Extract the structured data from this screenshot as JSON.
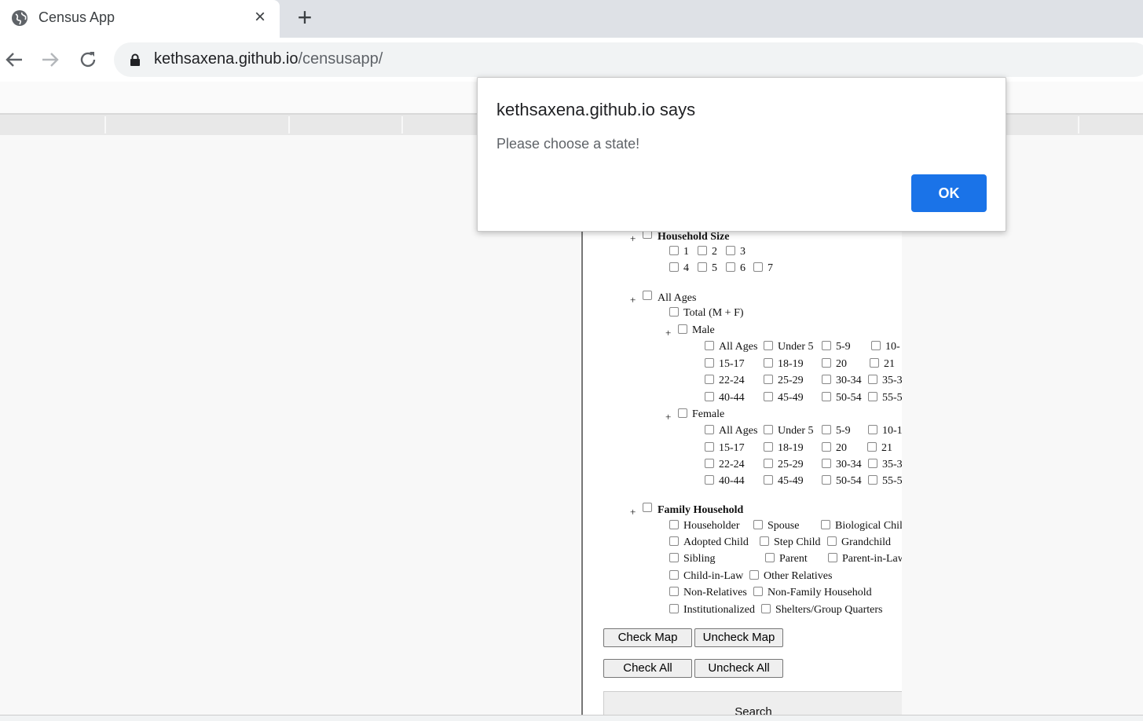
{
  "browser": {
    "tab_title": "Census App",
    "close_glyph": "×",
    "new_tab_glyph": "+",
    "url_host": "kethsaxena.github.io",
    "url_path": "/censusapp/"
  },
  "dialog": {
    "title": "kethsaxena.github.io says",
    "message": "Please choose a state!",
    "ok_label": "OK",
    "ok_color": "#1a73e8"
  },
  "form": {
    "household_size": {
      "label": "Household Size",
      "options": [
        "1",
        "2",
        "3",
        "4",
        "5",
        "6",
        "7"
      ]
    },
    "ages": {
      "label": "All Ages",
      "total": "Total (M + F)",
      "male": {
        "label": "Male",
        "options": [
          "All Ages",
          "Under 5",
          "5-9",
          "10-",
          "15-17",
          "18-19",
          "20",
          "21",
          "22-24",
          "25-29",
          "30-34",
          "35-3",
          "40-44",
          "45-49",
          "50-54",
          "55-5"
        ]
      },
      "female": {
        "label": "Female",
        "options": [
          "All Ages",
          "Under 5",
          "5-9",
          "10-1",
          "15-17",
          "18-19",
          "20",
          "21",
          "22-24",
          "25-29",
          "30-34",
          "35-3",
          "40-44",
          "45-49",
          "50-54",
          "55-5"
        ]
      }
    },
    "family": {
      "label": "Family Household",
      "options": [
        "Householder",
        "Spouse",
        "Biological Chil",
        "Adopted Child",
        "Step Child",
        "Grandchild",
        "Sibling",
        "Parent",
        "Parent-in-Law",
        "Child-in-Law",
        "Other Relatives",
        "Non-Relatives",
        "Non-Family Household",
        "Institutionalized",
        "Shelters/Group Quarters"
      ]
    },
    "plus_glyph": "+",
    "buttons": {
      "check_map": "Check Map",
      "uncheck_map": "Uncheck Map",
      "check_all": "Check All",
      "uncheck_all": "Uncheck All",
      "search": "Search"
    }
  }
}
